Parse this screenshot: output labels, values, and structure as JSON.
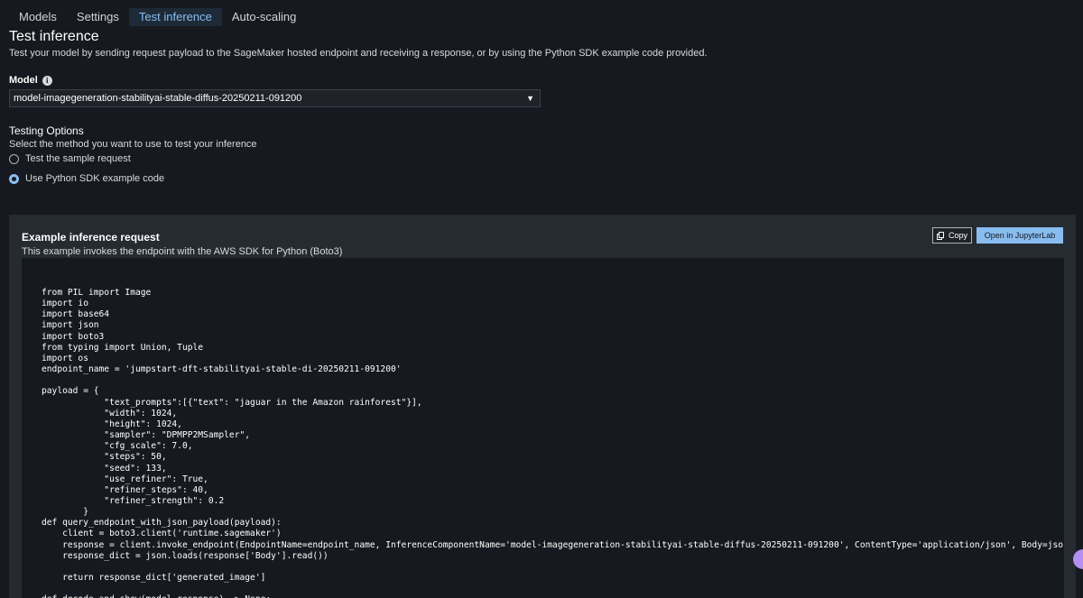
{
  "tabs": [
    {
      "label": "Models"
    },
    {
      "label": "Settings"
    },
    {
      "label": "Test inference"
    },
    {
      "label": "Auto-scaling"
    }
  ],
  "header": {
    "title": "Test inference",
    "subtitle": "Test your model by sending request payload to the SageMaker hosted endpoint and receiving a response, or by using the Python SDK example code provided."
  },
  "model": {
    "label": "Model",
    "info_icon": "info-icon",
    "selected": "model-imagegeneration-stabilityai-stable-diffus-20250211-091200"
  },
  "testing_options": {
    "title": "Testing Options",
    "description": "Select the method you want to use to test your inference",
    "options": [
      {
        "label": "Test the sample request",
        "selected": false
      },
      {
        "label": "Use Python SDK example code",
        "selected": true
      }
    ]
  },
  "example": {
    "title": "Example inference request",
    "subtitle": "This example invokes the endpoint with the AWS SDK for Python (Boto3)",
    "copy_label": "Copy",
    "open_label": "Open in JupyterLab",
    "code": "from PIL import Image\nimport io\nimport base64\nimport json\nimport boto3\nfrom typing import Union, Tuple\nimport os\nendpoint_name = 'jumpstart-dft-stabilityai-stable-di-20250211-091200'\n\npayload = {\n            \"text_prompts\":[{\"text\": \"jaguar in the Amazon rainforest\"}],\n            \"width\": 1024,\n            \"height\": 1024,\n            \"sampler\": \"DPMPP2MSampler\",\n            \"cfg_scale\": 7.0,\n            \"steps\": 50,\n            \"seed\": 133,\n            \"use_refiner\": True,\n            \"refiner_steps\": 40,\n            \"refiner_strength\": 0.2\n        }\ndef query_endpoint_with_json_payload(payload):\n    client = boto3.client('runtime.sagemaker')\n    response = client.invoke_endpoint(EndpointName=endpoint_name, InferenceComponentName='model-imagegeneration-stabilityai-stable-diffus-20250211-091200', ContentType='application/json', Body=json.dumps(payload))\n    response_dict = json.loads(response['Body'].read())\n\n    return response_dict['generated_image']\n\ndef decode_and_show(model_response) -> None:"
  },
  "colors": {
    "background": "#16191f",
    "accent": "#89bdf0",
    "panel": "#262b32"
  }
}
